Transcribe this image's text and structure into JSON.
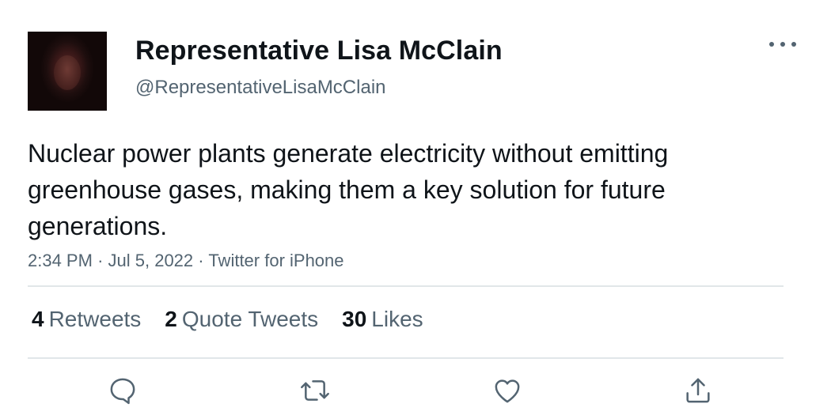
{
  "user": {
    "display_name": "Representative Lisa McClain",
    "handle": "@RepresentativeLisaMcClain"
  },
  "tweet": {
    "text": "Nuclear power plants generate electricity without emitting greenhouse gases, making them a key solution for future generations.",
    "time": "2:34 PM",
    "date": "Jul 5, 2022",
    "source": "Twitter for iPhone",
    "separator": "·"
  },
  "stats": {
    "retweets": {
      "count": "4",
      "label": "Retweets"
    },
    "quotes": {
      "count": "2",
      "label": "Quote Tweets"
    },
    "likes": {
      "count": "30",
      "label": "Likes"
    }
  },
  "icons": {
    "more": "more-horizontal-icon",
    "reply": "reply-icon",
    "retweet": "retweet-icon",
    "like": "heart-icon",
    "share": "share-icon"
  },
  "colors": {
    "text_primary": "#0f1419",
    "text_secondary": "#536471",
    "divider": "#e1e6e9"
  }
}
